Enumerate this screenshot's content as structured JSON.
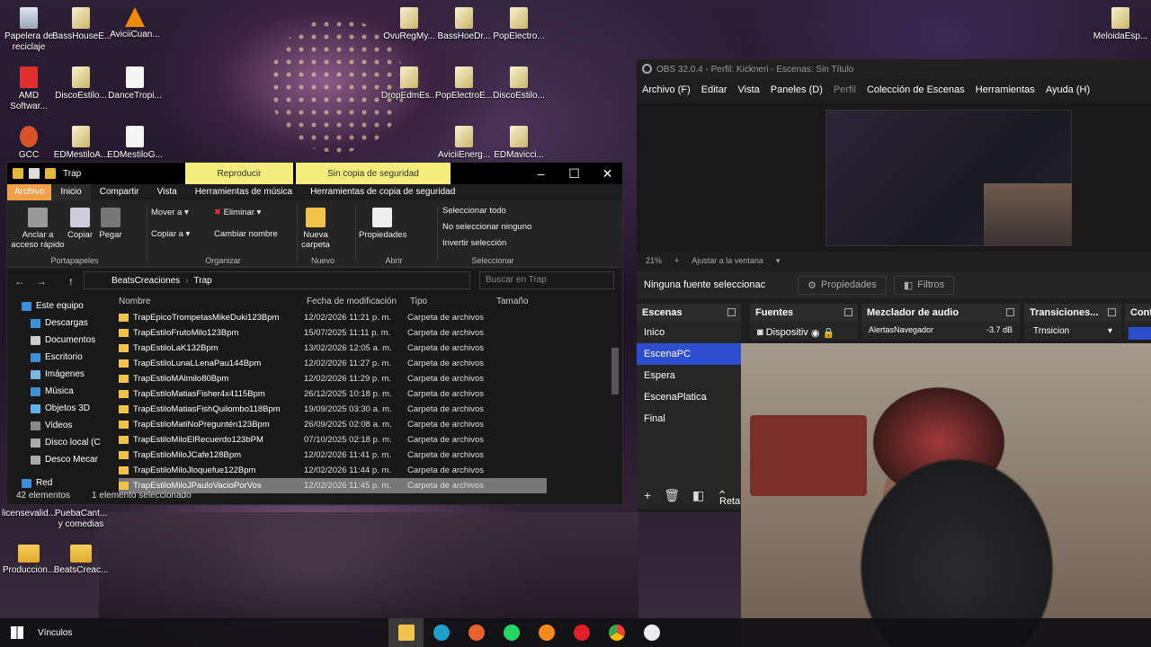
{
  "desktop": {
    "icons": [
      {
        "label": "Papelera de reciclaje",
        "icon": "recycle-bin-icon"
      },
      {
        "label": "BassHouseE...",
        "icon": "file-icon"
      },
      {
        "label": "AviciiCuan...",
        "icon": "vlc-icon"
      },
      {
        "label": "OvuRegMy...",
        "icon": "file-icon"
      },
      {
        "label": "BassHoeDr...",
        "icon": "file-icon"
      },
      {
        "label": "PopElectro...",
        "icon": "file-icon"
      },
      {
        "label": "MeloidaEsp...",
        "icon": "file-icon"
      },
      {
        "label": "AMD Softwar...",
        "icon": "amd-icon"
      },
      {
        "label": "DiscoEstilo...",
        "icon": "file-icon"
      },
      {
        "label": "DanceTropi...",
        "icon": "file-icon"
      },
      {
        "label": "DropEdmEs...",
        "icon": "file-icon"
      },
      {
        "label": "PopElectroE...",
        "icon": "file-icon"
      },
      {
        "label": "DiscoEstilo...",
        "icon": "file-icon"
      },
      {
        "label": "GCC",
        "icon": "gcc-icon"
      },
      {
        "label": "EDMestiloA...",
        "icon": "file-icon"
      },
      {
        "label": "EDMestiloG...",
        "icon": "file-icon"
      },
      {
        "label": "AviciiEnerg...",
        "icon": "file-icon"
      },
      {
        "label": "EDMavicci...",
        "icon": "file-icon"
      },
      {
        "label": "licensevalid...",
        "icon": "file-icon"
      },
      {
        "label": "PuebaCant... y comedias",
        "icon": "file-icon"
      },
      {
        "label": "Produccion...",
        "icon": "folder-icon"
      },
      {
        "label": "BeatsCreac...",
        "icon": "folder-icon"
      }
    ]
  },
  "explorer": {
    "title": "Trap",
    "context_tabs": [
      "Reproducir",
      "Sin copia de seguridad"
    ],
    "ribbon_tabs": [
      "Archivo",
      "Inicio",
      "Compartir",
      "Vista",
      "Herramientas de música",
      "Herramientas de copia de seguridad"
    ],
    "ribbon": {
      "anclar": "Anclar a acceso rápido",
      "copiar": "Copiar",
      "pegar": "Pegar",
      "portapapeles": "Portapapeles",
      "mover": "Mover a",
      "copiar_a": "Copiar a",
      "eliminar": "Eliminar",
      "cambiar": "Cambiar nombre",
      "organizar": "Organizar",
      "nueva": "Nueva carpeta",
      "nuevo": "Nuevo",
      "propiedades": "Propiedades",
      "abrir": "Abrir",
      "sel_todo": "Seleccionar todo",
      "no_sel": "No seleccionar ninguno",
      "invertir": "Invertir selección",
      "seleccionar": "Seleccionar"
    },
    "path": [
      "BeatsCreaciones",
      "Trap"
    ],
    "search_placeholder": "Buscar en Trap",
    "nav": [
      "Este equipo",
      "Descargas",
      "Documentos",
      "Escritorio",
      "Imágenes",
      "Música",
      "Objetos 3D",
      "Videos",
      "Disco local (C",
      "Desco Mecar",
      "Red"
    ],
    "columns": [
      "Nombre",
      "Fecha de modificación",
      "Tipo",
      "Tamaño"
    ],
    "files": [
      {
        "name": "TrapEpicoTrompetasMikeDuki123Bpm",
        "date": "12/02/2026 11:21 p. m.",
        "type": "Carpeta de archivos"
      },
      {
        "name": "TrapEstiloFrutoMilo123Bpm",
        "date": "15/07/2025 11:11 p. m.",
        "type": "Carpeta de archivos"
      },
      {
        "name": "TrapEstiloLaK132Bpm",
        "date": "13/02/2026 12:05 a. m.",
        "type": "Carpeta de archivos"
      },
      {
        "name": "TrapEstiloLunaLLenaPau144Bpm",
        "date": "12/02/2026 11:27 p. m.",
        "type": "Carpeta de archivos"
      },
      {
        "name": "TrapEstiloMAlmilo80Bpm",
        "date": "12/02/2026 11:29 p. m.",
        "type": "Carpeta de archivos"
      },
      {
        "name": "TrapEstiloMatiasFisher4x4115Bpm",
        "date": "26/12/2025 10:18 p. m.",
        "type": "Carpeta de archivos"
      },
      {
        "name": "TrapEstiloMatiasFishQuilombo118Bpm",
        "date": "19/09/2025 03:30 a. m.",
        "type": "Carpeta de archivos"
      },
      {
        "name": "TrapEstiloMatiNoPreguntén123Bpm",
        "date": "26/09/2025 02:08 a. m.",
        "type": "Carpeta de archivos"
      },
      {
        "name": "TrapEstiloMiloElRecuerdo123bPM",
        "date": "07/10/2025 02:18 p. m.",
        "type": "Carpeta de archivos"
      },
      {
        "name": "TrapEstiloMiloJCafe128Bpm",
        "date": "12/02/2026 11:41 p. m.",
        "type": "Carpeta de archivos"
      },
      {
        "name": "TrapEstiloMiloJloquefue122Bpm",
        "date": "12/02/2026 11:44 p. m.",
        "type": "Carpeta de archivos"
      },
      {
        "name": "TrapEstiloMiloJPauloVacioPorVos",
        "date": "12/02/2026 11:45 p. m.",
        "type": "Carpeta de archivos"
      }
    ],
    "status_count": "42 elementos",
    "status_sel": "1 elemento seleccionado"
  },
  "obs": {
    "title": "OBS 32.0.4 - Perfil: Kickneri - Escenas: Sin Título",
    "menu": [
      "Archivo (F)",
      "Editar",
      "Vista",
      "Paneles (D)",
      "Perfil",
      "Colección de Escenas",
      "Herramientas",
      "Ayuda (H)"
    ],
    "zoom": "21%",
    "fit": "Ajustar a la ventana",
    "no_source": "Ninguna fuente seleccionac",
    "props": "Propiedades",
    "filters": "Filtros",
    "docks": [
      "Escenas",
      "Fuentes",
      "Mezclador de audio",
      "Transiciones...",
      "Contr"
    ],
    "scenes": [
      "Inico",
      "EscenaPC",
      "Espera",
      "EscenaPlatica",
      "Final"
    ],
    "active_scene": "EscenaPC",
    "source": "Dispositiv",
    "mixer_name": "AlertasNavegador",
    "mixer_db": "-3.7 dB",
    "transition": "Trnsicion",
    "retar": "Retar"
  },
  "taskbar": {
    "vinculos": "Vínculos"
  }
}
